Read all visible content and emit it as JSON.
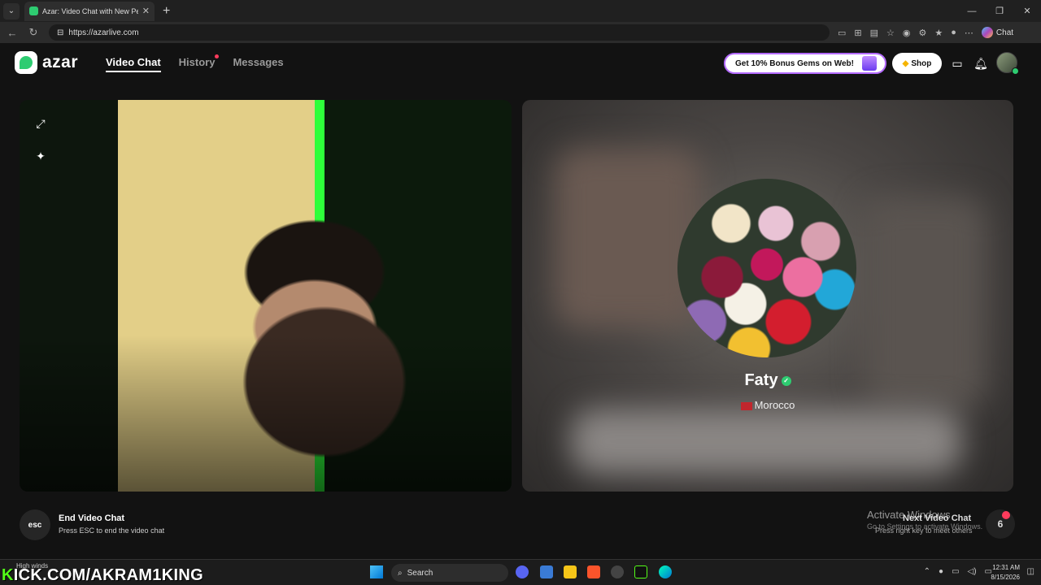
{
  "browser": {
    "tab_title": "Azar: Video Chat with New Pe",
    "url": "https://azarlive.com",
    "copilot_label": "Chat"
  },
  "app": {
    "logo_text": "azar",
    "nav": [
      "Video Chat",
      "History",
      "Messages"
    ],
    "promo_text": "Get 10% Bonus Gems on Web!",
    "shop_label": "Shop"
  },
  "partner": {
    "name": "Faty",
    "country": "Morocco"
  },
  "controls": {
    "end_key": "esc",
    "end_title": "End Video Chat",
    "end_sub": "Press ESC to end the video chat",
    "next_title": "Next Video Chat",
    "next_sub": "Press right key to meet others",
    "next_count": "6"
  },
  "watermark": {
    "title": "Activate Windows",
    "sub": "Go to Settings to activate Windows."
  },
  "overlay": {
    "kick_prefix": "K",
    "kick_rest": "KICK.COM/AKRAM1KING"
  },
  "taskbar": {
    "weather": "High winds",
    "search": "Search",
    "time": "12:31 AM",
    "date": "8/15/2026"
  },
  "colors": {
    "brand_green": "#2ecc71",
    "notification_red": "#ff3b5c",
    "promo_border": "#b46bff"
  }
}
